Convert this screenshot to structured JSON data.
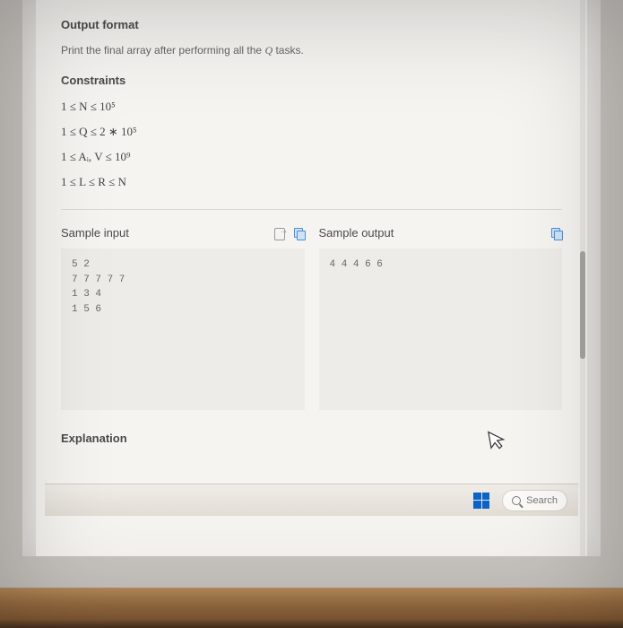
{
  "headings": {
    "output_format": "Output format",
    "constraints": "Constraints",
    "sample_input": "Sample input",
    "sample_output": "Sample output",
    "explanation": "Explanation"
  },
  "output_format_text_pre": "Print the final array after performing all the ",
  "output_format_q": "Q",
  "output_format_text_post": " tasks.",
  "constraints": [
    "1 ≤ N ≤ 10⁵",
    "1 ≤ Q ≤ 2 ∗ 10⁵",
    "1 ≤ Aᵢ, V ≤ 10⁹",
    "1 ≤ L ≤ R ≤ N"
  ],
  "sample_input": "5 2\n7 7 7 7 7\n1 3 4\n1 5 6",
  "sample_output": "4 4 4 6 6",
  "taskbar": {
    "search_placeholder": "Search"
  }
}
